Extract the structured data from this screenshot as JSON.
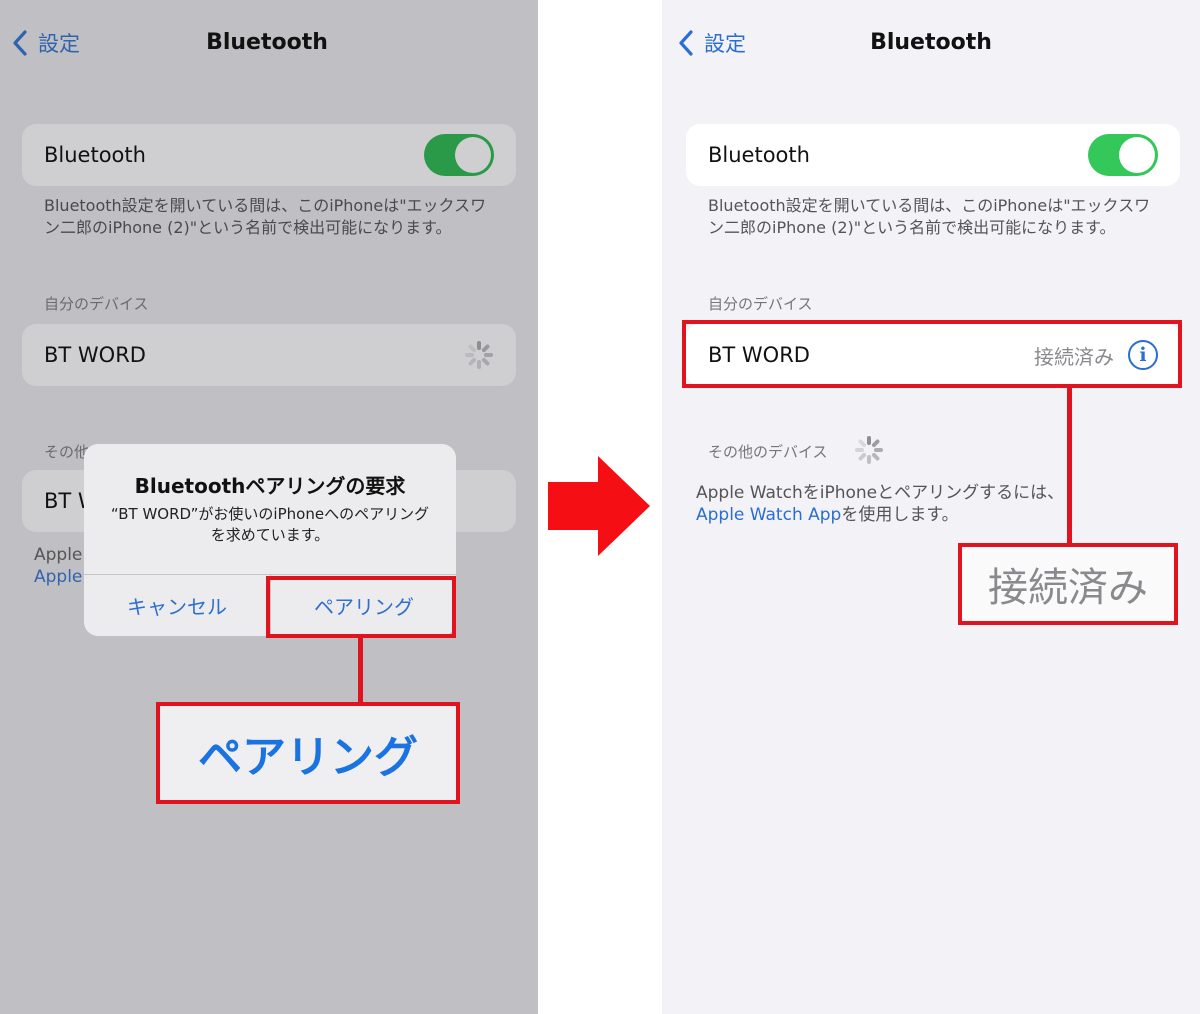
{
  "left_screen": {
    "nav": {
      "back_label": "設定",
      "title": "Bluetooth"
    },
    "bluetooth_toggle": {
      "label": "Bluetooth",
      "on": true
    },
    "discoverable_note": "Bluetooth設定を開いている間は、このiPhoneは\"エックスワン二郎のiPhone (2)\"という名前で検出可能になります。",
    "my_devices_header": "自分のデバイス",
    "my_devices": [
      {
        "name": "BT WORD",
        "status": "connecting"
      }
    ],
    "other_devices_header": "その他のデバイス",
    "other_devices_partial": "BT WORD",
    "apple_note_partial_1": "Apple",
    "apple_note_partial_2": "Apple",
    "dialog": {
      "title": "Bluetoothペアリングの要求",
      "message": "“BT WORD”がお使いのiPhoneへのペアリングを求めています。",
      "cancel_label": "キャンセル",
      "pair_label": "ペアリング"
    },
    "callout": "ペアリング"
  },
  "right_screen": {
    "nav": {
      "back_label": "設定",
      "title": "Bluetooth"
    },
    "bluetooth_toggle": {
      "label": "Bluetooth",
      "on": true
    },
    "discoverable_note": "Bluetooth設定を開いている間は、このiPhoneは\"エックスワン二郎のiPhone (2)\"という名前で検出可能になります。",
    "my_devices_header": "自分のデバイス",
    "my_devices": [
      {
        "name": "BT WORD",
        "status": "接続済み"
      }
    ],
    "other_devices_header": "その他のデバイス",
    "apple_note_text": "Apple WatchをiPhoneとペアリングするには、",
    "apple_note_link": "Apple Watch App",
    "apple_note_suffix": "を使用します。",
    "callout": "接続済み"
  },
  "colors": {
    "annotation_red": "#e0141e",
    "ios_blue": "#2a6ed1",
    "toggle_green": "#34c759"
  }
}
